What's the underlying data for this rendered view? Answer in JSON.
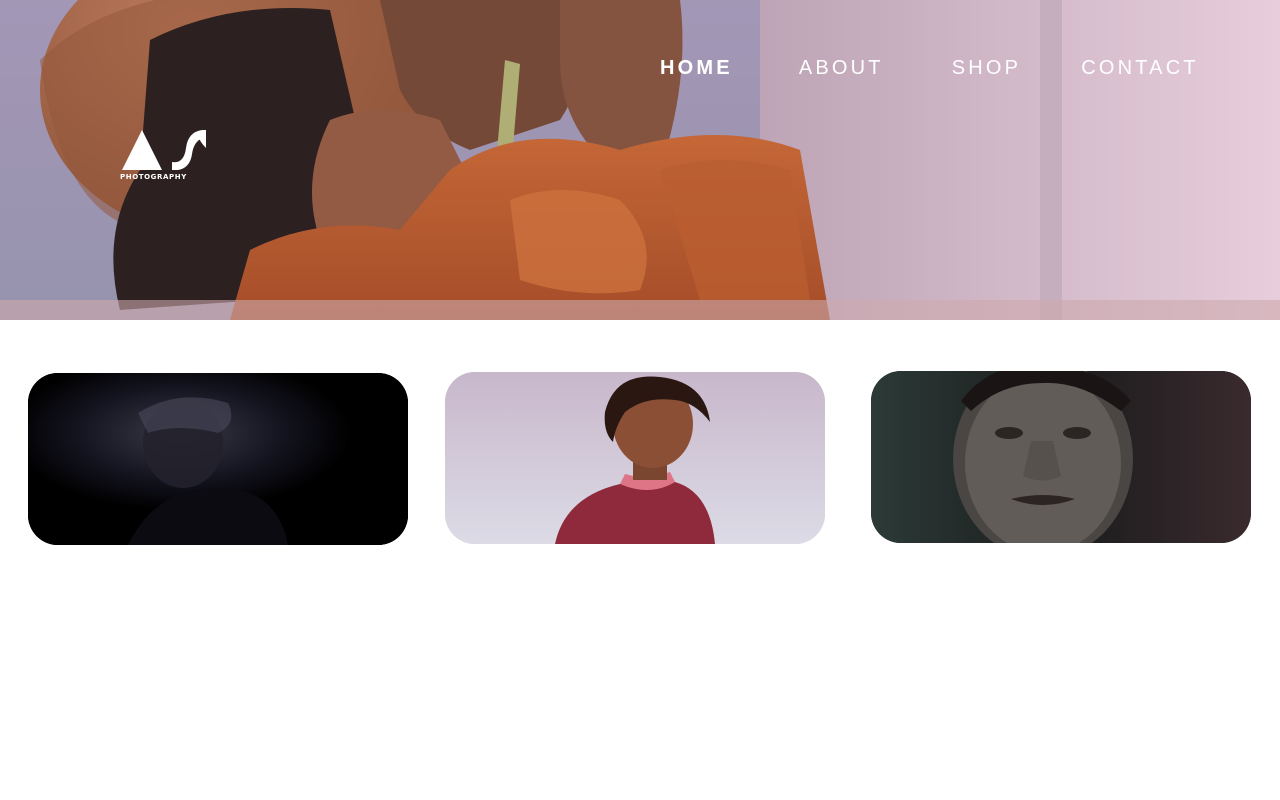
{
  "brand": {
    "logo_letters": "AS",
    "logo_subtitle": "PHOTOGRAPHY"
  },
  "nav": {
    "items": [
      {
        "label": "HOME",
        "active": true
      },
      {
        "label": "ABOUT",
        "active": false
      },
      {
        "label": "SHOP",
        "active": false
      },
      {
        "label": "CONTACT",
        "active": false
      }
    ]
  },
  "hero": {
    "image": "woman-in-orange-sweater-holding-stem-photo"
  },
  "gallery": {
    "cards": [
      {
        "image": "dark-low-light-portrait-photo"
      },
      {
        "image": "young-man-red-shirt-sky-photo"
      },
      {
        "image": "man-close-up-portrait-dark-background-photo"
      }
    ]
  },
  "colors": {
    "nav_text": "#ffffff",
    "page_background": "#ffffff"
  }
}
